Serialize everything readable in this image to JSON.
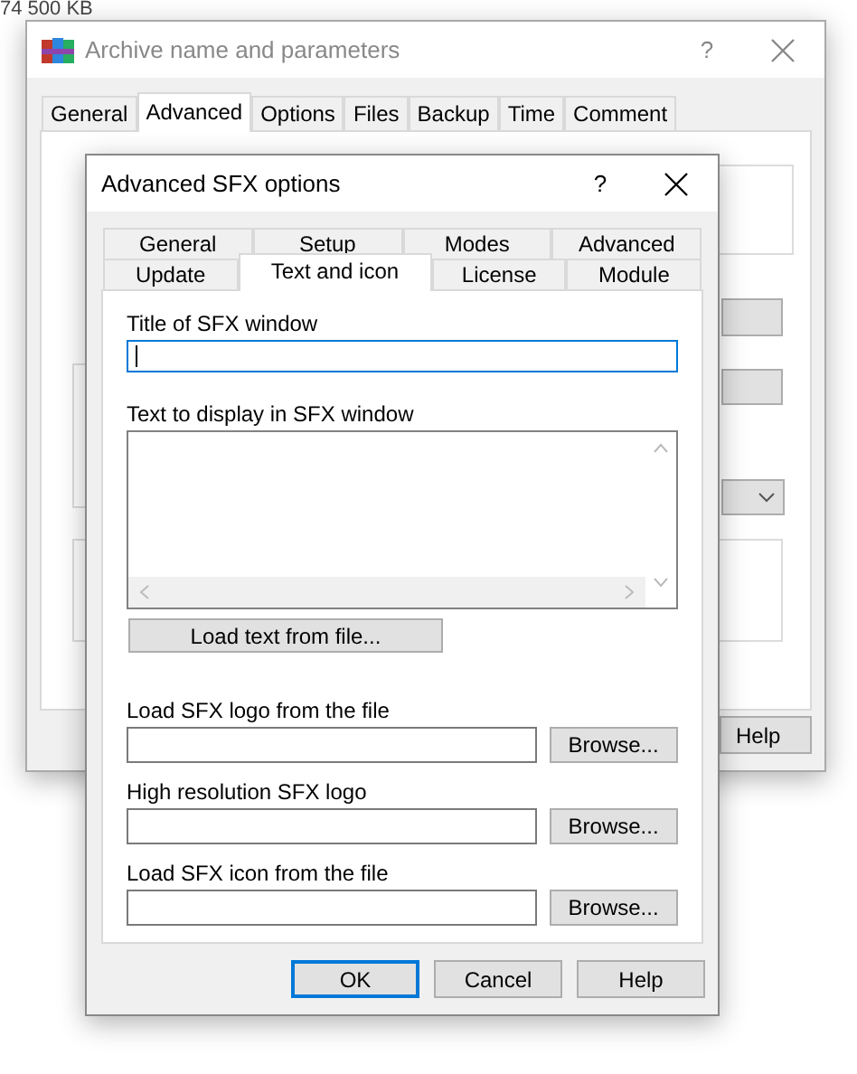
{
  "size_label": "74 500 KB",
  "background_window": {
    "title": "Archive name and parameters",
    "help_glyph": "?",
    "tabs": [
      {
        "label": "General",
        "selected": false
      },
      {
        "label": "Advanced",
        "selected": true
      },
      {
        "label": "Options",
        "selected": false
      },
      {
        "label": "Files",
        "selected": false
      },
      {
        "label": "Backup",
        "selected": false
      },
      {
        "label": "Time",
        "selected": false
      },
      {
        "label": "Comment",
        "selected": false
      }
    ],
    "buttons": [
      "Help"
    ]
  },
  "dialog": {
    "title": "Advanced SFX options",
    "help_glyph": "?",
    "tab_rows": [
      [
        {
          "label": "General",
          "selected": false
        },
        {
          "label": "Setup",
          "selected": false
        },
        {
          "label": "Modes",
          "selected": false
        },
        {
          "label": "Advanced",
          "selected": false
        }
      ],
      [
        {
          "label": "Update",
          "selected": false
        },
        {
          "label": "Text and icon",
          "selected": true
        },
        {
          "label": "License",
          "selected": false
        },
        {
          "label": "Module",
          "selected": false
        }
      ]
    ],
    "fields": [
      {
        "kind": "line",
        "label": "Title of SFX window",
        "focused": true
      },
      {
        "kind": "memo",
        "label": "Text to display in SFX window",
        "button": "Load text from file..."
      },
      {
        "kind": "file",
        "label": "Load SFX logo from the file",
        "button": "Browse..."
      },
      {
        "kind": "file",
        "label": "High resolution SFX logo",
        "button": "Browse..."
      },
      {
        "kind": "file",
        "label": "Load SFX icon from the file",
        "button": "Browse..."
      }
    ],
    "buttons": [
      {
        "label": "OK",
        "default": true
      },
      {
        "label": "Cancel",
        "default": false
      },
      {
        "label": "Help",
        "default": false
      }
    ]
  }
}
